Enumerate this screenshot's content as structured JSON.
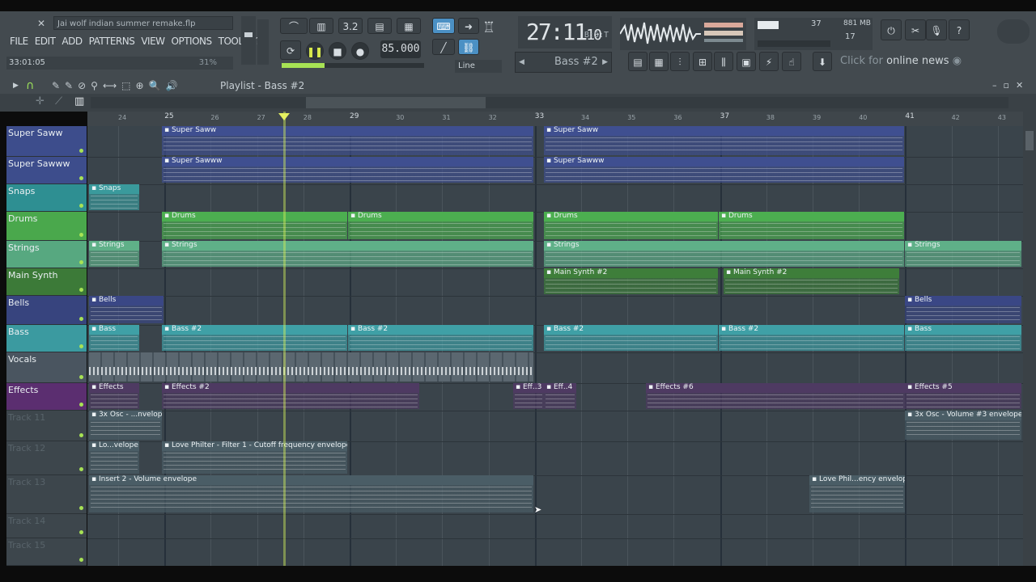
{
  "app": {
    "project_title": "Jai wolf indian summer remake.flp",
    "menu": [
      "FILE",
      "EDIT",
      "ADD",
      "PATTERNS",
      "VIEW",
      "OPTIONS",
      "TOOLS",
      "?"
    ],
    "hint_time": "33:01:05",
    "hint_pct": "31%"
  },
  "transport": {
    "time": "27:11",
    "time_sub": "10",
    "time_label": "B:S:T",
    "tempo": "85.000",
    "mode": "Line",
    "pattern": "Bass #2",
    "memory": "881 MB",
    "cpu": "37",
    "poly": "17",
    "news_prefix": "Click for",
    "news_text": "online news"
  },
  "playlist": {
    "title": "Playlist - Bass #2",
    "arrow": "›",
    "ruler": [
      "24",
      "25",
      "26",
      "27",
      "28",
      "29",
      "30",
      "31",
      "32",
      "33",
      "34",
      "35",
      "36",
      "37",
      "38",
      "39",
      "40",
      "41",
      "42",
      "43"
    ],
    "tracks": [
      {
        "name": "Super Saww",
        "color": "#3d4d8c"
      },
      {
        "name": "Super Sawww",
        "color": "#3d4d8c"
      },
      {
        "name": "Snaps",
        "color": "#2e8f92"
      },
      {
        "name": "Drums",
        "color": "#4aa84c"
      },
      {
        "name": "Strings",
        "color": "#57a880"
      },
      {
        "name": "Main Synth",
        "color": "#3c7a38"
      },
      {
        "name": "Bells",
        "color": "#37447e"
      },
      {
        "name": "Bass",
        "color": "#3b9aa0"
      },
      {
        "name": "Vocals",
        "color": "#4a5560"
      },
      {
        "name": "Effects",
        "color": "#5b2e70"
      },
      {
        "name": "Track 11",
        "color": "#3d464c"
      },
      {
        "name": "Track 12",
        "color": "#3d464c"
      },
      {
        "name": "Track 13",
        "color": "#3d464c"
      },
      {
        "name": "Track 14",
        "color": "#3d464c"
      },
      {
        "name": "Track 15",
        "color": "#3d464c"
      }
    ],
    "clips": {
      "super_saww_1": "Super Saww",
      "super_saww_2": "Super Saww",
      "super_sawww_1": "Super Sawww",
      "super_sawww_2": "Super Sawww",
      "snaps": "Snaps",
      "drums_1": "Drums",
      "drums_2": "Drums",
      "drums_3": "Drums",
      "drums_4": "Drums",
      "strings_1": "Strings",
      "strings_2": "Strings",
      "strings_3": "Strings",
      "strings_4": "Strings",
      "main_synth_1": "Main Synth #2",
      "main_synth_2": "Main Synth #2",
      "bells_1": "Bells",
      "bells_2": "Bells",
      "bass_1": "Bass",
      "bass_2": "Bass #2",
      "bass_3": "Bass #2",
      "bass_4": "Bass #2",
      "bass_5": "Bass #2",
      "bass_6": "Bass",
      "effects_1": "Effects",
      "effects_2": "Effects #2",
      "effects_3": "Eff..3",
      "effects_4": "Eff..4",
      "effects_5": "Effects #6",
      "effects_6": "Effects #5",
      "env_1": "3x Osc - ...nvelope",
      "env_2": "3x Osc - Volume #3 envelope",
      "env_3": "Lo...velope",
      "env_4": "Love Philter - Filter 1 - Cutoff frequency envelope",
      "env_5": "Insert 2 - Volume envelope",
      "env_6": "Love Phil...ency envelope"
    }
  },
  "colors": {
    "accent": "#4b90c4",
    "playhead": "#dfef62",
    "led": "#a7e254"
  }
}
